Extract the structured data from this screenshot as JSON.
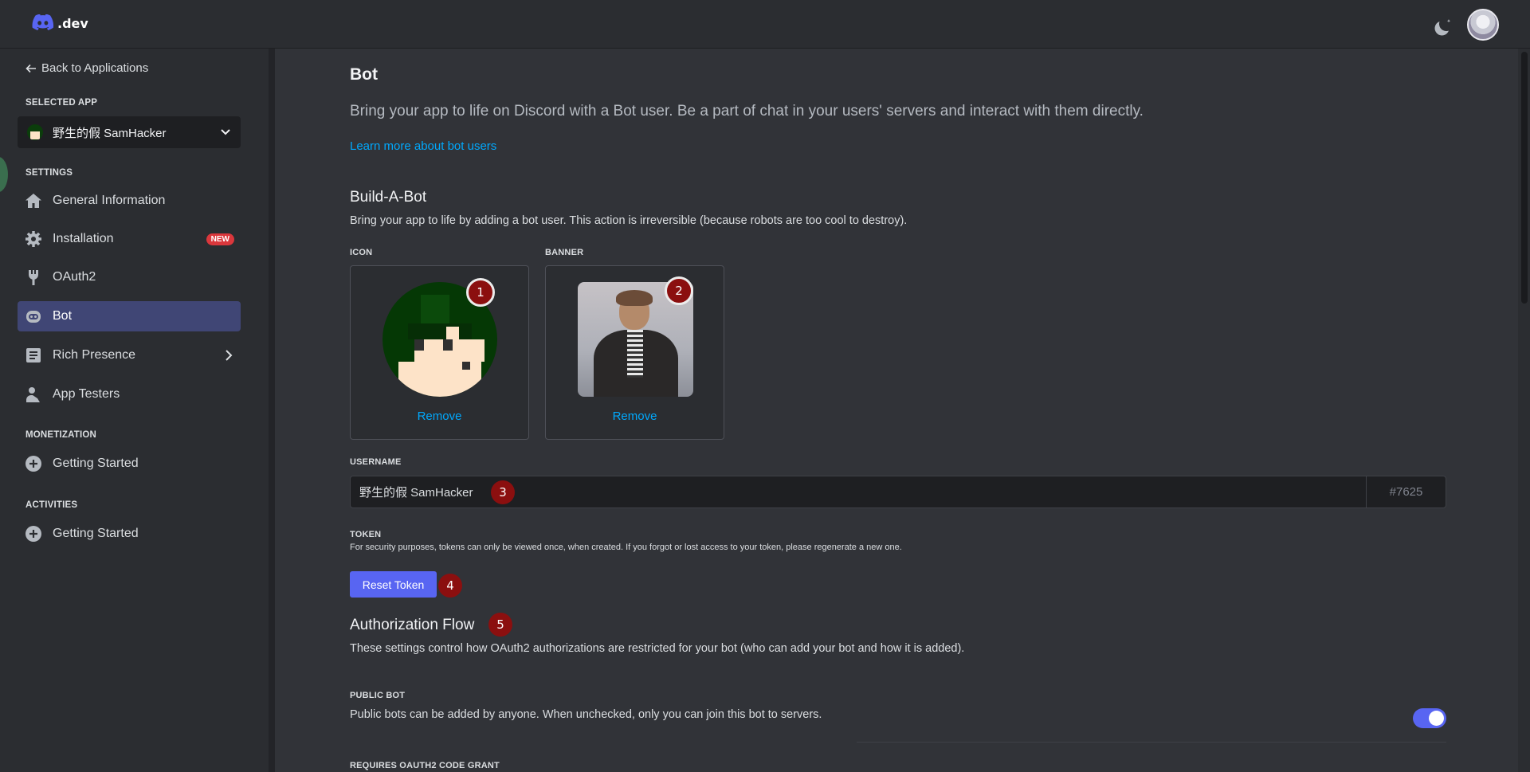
{
  "topbar": {
    "logo_text": ".dev",
    "theme_icon": "moon-icon",
    "avatar_icon": "user-avatar"
  },
  "sidebar": {
    "back_label": "Back to Applications",
    "selected_app_label": "SELECTED APP",
    "selected_app_name": "野生的假 SamHacker",
    "settings_label": "SETTINGS",
    "items": [
      {
        "label": "General Information",
        "icon": "home-icon"
      },
      {
        "label": "Installation",
        "icon": "gear-icon",
        "badge": "NEW"
      },
      {
        "label": "OAuth2",
        "icon": "wrench-icon"
      },
      {
        "label": "Bot",
        "icon": "bot-icon",
        "active": true
      },
      {
        "label": "Rich Presence",
        "icon": "document-icon"
      },
      {
        "label": "App Testers",
        "icon": "person-icon"
      }
    ],
    "monetization_label": "MONETIZATION",
    "monetization_item": "Getting Started",
    "activities_label": "ACTIVITIES",
    "activities_item": "Getting Started"
  },
  "main": {
    "title": "Bot",
    "description": "Bring your app to life on Discord with a Bot user. Be a part of chat in your users' servers and interact with them directly.",
    "learn_more": "Learn more about bot users",
    "build_title": "Build-A-Bot",
    "build_desc": "Bring your app to life by adding a bot user. This action is irreversible (because robots are too cool to destroy).",
    "icon_label": "ICON",
    "banner_label": "BANNER",
    "remove_label": "Remove",
    "username_label": "USERNAME",
    "username_value": "野生的假 SamHacker",
    "discriminator": "#7625",
    "token_label": "TOKEN",
    "token_note": "For security purposes, tokens can only be viewed once, when created. If you forgot or lost access to your token, please regenerate a new one.",
    "reset_token": "Reset Token",
    "auth_title": "Authorization Flow",
    "auth_desc": "These settings control how OAuth2 authorizations are restricted for your bot (who can add your bot and how it is added).",
    "public_bot_label": "PUBLIC BOT",
    "public_bot_desc": "Public bots can be added by anyone. When unchecked, only you can join this bot to servers.",
    "public_bot_enabled": true,
    "requires_grant_label": "REQUIRES OAUTH2 CODE GRANT"
  },
  "markers": [
    "1",
    "2",
    "3",
    "4",
    "5"
  ],
  "colors": {
    "accent": "#5865f2",
    "link": "#00a8fc",
    "marker": "#8b0f0f",
    "badge": "#da373c"
  }
}
